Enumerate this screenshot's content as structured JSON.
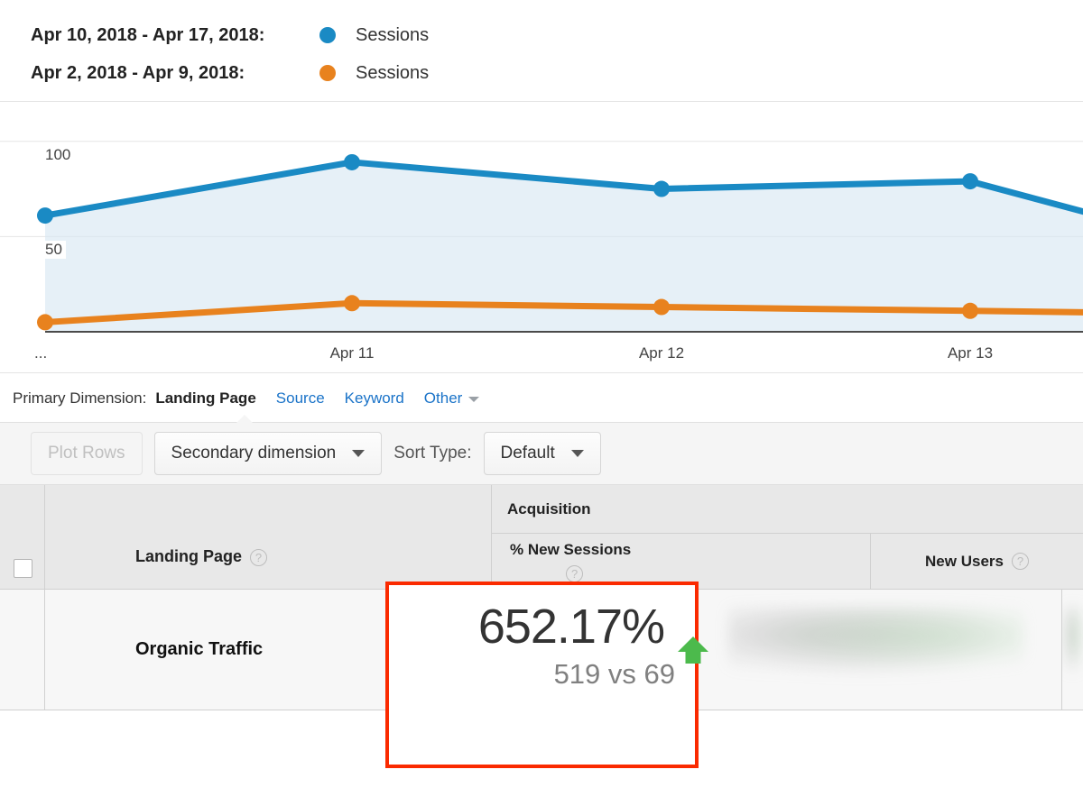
{
  "legend": {
    "rows": [
      {
        "range": "Apr 10, 2018 - Apr 17, 2018:",
        "metric": "Sessions",
        "color": "#1a8ac4"
      },
      {
        "range": "Apr 2, 2018 - Apr 9, 2018:",
        "metric": "Sessions",
        "color": "#e8821e"
      }
    ]
  },
  "chart_data": {
    "type": "line",
    "title": "",
    "xlabel": "",
    "ylabel": "",
    "ylim": [
      0,
      115
    ],
    "yticks": [
      100,
      50
    ],
    "grid": true,
    "legend_position": "top",
    "x": [
      "...",
      "Apr 11",
      "Apr 12",
      "Apr 13",
      ""
    ],
    "xtick_labels": [
      "...",
      "Apr 11",
      "Apr 12",
      "Apr 13"
    ],
    "series": [
      {
        "name": "Sessions",
        "period": "Apr 10, 2018 - Apr 17, 2018",
        "color": "#1a8ac4",
        "fill": "#e6f0f7",
        "values": [
          61,
          89,
          75,
          79,
          58
        ]
      },
      {
        "name": "Sessions",
        "period": "Apr 2, 2018 - Apr 9, 2018",
        "color": "#e8821e",
        "fill": "none",
        "values": [
          5,
          15,
          13,
          11,
          10
        ]
      }
    ]
  },
  "primary_dimension": {
    "label": "Primary Dimension:",
    "active": "Landing Page",
    "links": [
      "Source",
      "Keyword"
    ],
    "other": "Other"
  },
  "toolbar": {
    "plot_rows": "Plot Rows",
    "secondary_dimension": "Secondary dimension",
    "sort_type_label": "Sort Type:",
    "sort_type_value": "Default"
  },
  "table": {
    "landing_page_header": "Landing Page",
    "group_header": "Acquisition",
    "columns": [
      "% New Sessions",
      "New Users"
    ],
    "help_icon": "?",
    "rows": [
      {
        "landing_page": "Organic Traffic"
      }
    ]
  },
  "callout": {
    "percent": "652.17%",
    "direction": "up",
    "arrow_color": "#4cba4c",
    "comparison": "519 vs 69",
    "border_color": "#fa2a00"
  }
}
